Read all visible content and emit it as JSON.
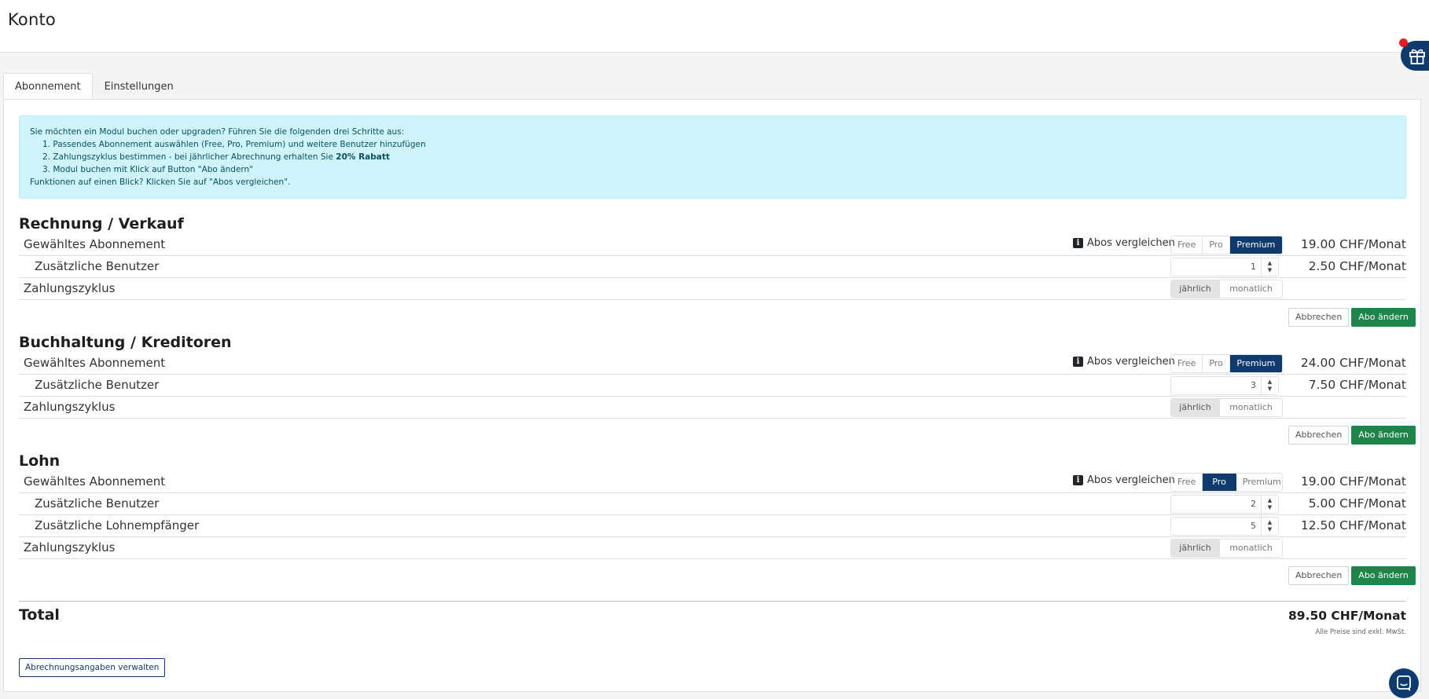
{
  "page": {
    "title": "Konto"
  },
  "tabs": [
    {
      "label": "Abonnement",
      "active": true
    },
    {
      "label": "Einstellungen",
      "active": false
    }
  ],
  "info": {
    "intro": "Sie möchten ein Modul buchen oder upgraden? Führen Sie die folgenden drei Schritte aus:",
    "step1": "1. Passendes Abonnement auswählen (Free, Pro, Premium) und weitere Benutzer hinzufügen",
    "step2_prefix": "2. Zahlungszyklus bestimmen - bei jährlicher Abrechnung erhalten Sie ",
    "step2_bold": "20% Rabatt",
    "step3": "3. Modul buchen mit Klick auf Button \"Abo ändern\"",
    "footer": "Funktionen auf einen Blick? Klicken Sie auf \"Abos vergleichen\"."
  },
  "labels": {
    "plan": "Gewähltes Abonnement",
    "users": "Zusätzliche Benutzer",
    "payees": "Zusätzliche Lohnempfänger",
    "cycle": "Zahlungszyklus",
    "compare": "Abos vergleichen",
    "plan_free": "Free",
    "plan_pro": "Pro",
    "plan_premium": "Premium",
    "cycle_yearly": "jährlich",
    "cycle_monthly": "monatlich",
    "cancel": "Abbrechen",
    "change": "Abo ändern"
  },
  "modules": {
    "rechnung": {
      "title": "Rechnung / Verkauf",
      "selected_plan": "Premium",
      "plan_price": "19.00 CHF/Monat",
      "users": "1",
      "users_price": "2.50 CHF/Monat",
      "selected_cycle": "jährlich"
    },
    "buchhaltung": {
      "title": "Buchhaltung / Kreditoren",
      "selected_plan": "Premium",
      "plan_price": "24.00 CHF/Monat",
      "users": "3",
      "users_price": "7.50 CHF/Monat",
      "selected_cycle": "jährlich"
    },
    "lohn": {
      "title": "Lohn",
      "selected_plan": "Pro",
      "plan_price": "19.00 CHF/Monat",
      "users": "2",
      "users_price": "5.00 CHF/Monat",
      "payees": "5",
      "payees_price": "12.50 CHF/Monat",
      "selected_cycle": "jährlich"
    }
  },
  "total": {
    "label": "Total",
    "value": "89.50 CHF/Monat",
    "vat_note": "Alle Preise sind exkl. MwSt."
  },
  "billing_button": "Abrechnungsangaben verwalten",
  "colors": {
    "primary": "#0f3a6e",
    "success": "#1e8449",
    "info_bg": "#cff4fc",
    "notification": "#e51b24"
  },
  "icons": {
    "info": "info-icon",
    "gift": "gift-icon",
    "chat": "chat-icon"
  }
}
